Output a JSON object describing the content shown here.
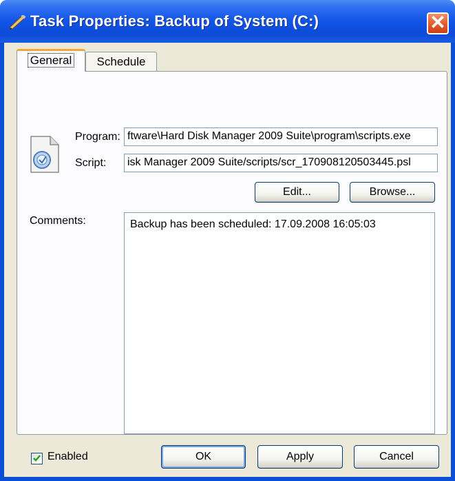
{
  "window": {
    "title": "Task Properties: Backup of System (C:)",
    "close_glyph": "✕"
  },
  "tabs": [
    {
      "label": "General",
      "active": true
    },
    {
      "label": "Schedule",
      "active": false
    }
  ],
  "general": {
    "program_label": "Program:",
    "program_value": "ftware\\Hard Disk Manager 2009 Suite\\program\\scripts.exe",
    "script_label": "Script:",
    "script_value": "isk Manager 2009 Suite/scripts/scr_170908120503445.psl",
    "edit_label": "Edit...",
    "browse_label": "Browse...",
    "comments_label": "Comments:",
    "comments_value": "Backup has been scheduled: 17.09.2008 16:05:03",
    "enabled_label": "Enabled",
    "enabled_checked": true
  },
  "footer": {
    "ok_label": "OK",
    "apply_label": "Apply",
    "cancel_label": "Cancel"
  },
  "colors": {
    "titlebar": "#0e4bd8",
    "client": "#ece9d8",
    "tab_accent": "#f0a53a",
    "close_button": "#e35a2b"
  },
  "icons": {
    "title": "task-pencil-icon",
    "program": "script-file-icon",
    "close": "close-icon",
    "check": "checkmark-icon"
  }
}
